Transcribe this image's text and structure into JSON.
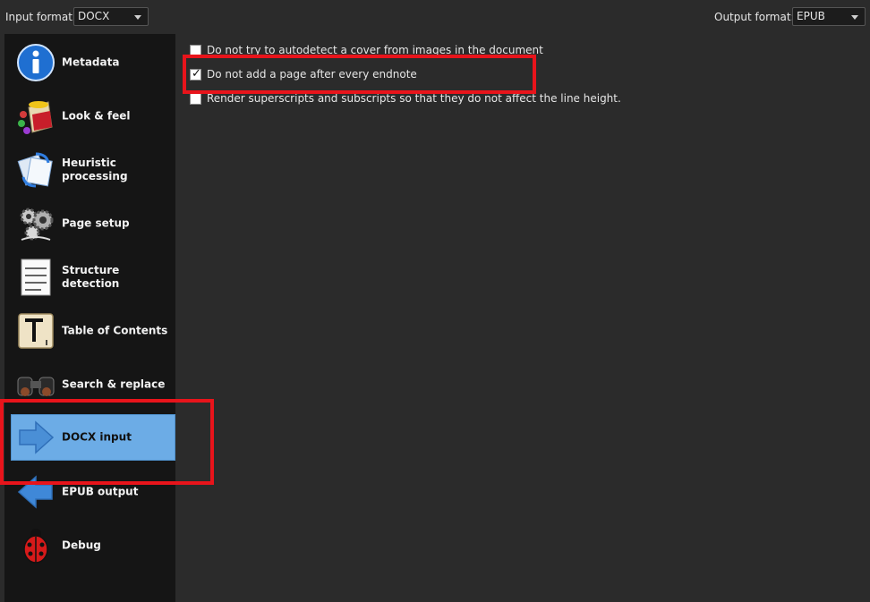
{
  "header": {
    "input_format_label": "Input format:",
    "input_format_value": "DOCX",
    "output_format_label": "Output format:",
    "output_format_value": "EPUB"
  },
  "sidebar": {
    "items": [
      {
        "label": "Metadata",
        "icon": "info-icon"
      },
      {
        "label": "Look & feel",
        "icon": "paint-bucket-icon"
      },
      {
        "label": "Heuristic processing",
        "icon": "heuristic-icon"
      },
      {
        "label": "Page setup",
        "icon": "gears-icon"
      },
      {
        "label": "Structure detection",
        "icon": "document-lines-icon"
      },
      {
        "label": "Table of Contents",
        "icon": "letter-tile-icon"
      },
      {
        "label": "Search & replace",
        "icon": "binoculars-icon"
      },
      {
        "label": "DOCX input",
        "icon": "arrow-right-icon"
      },
      {
        "label": "EPUB output",
        "icon": "arrow-left-icon"
      },
      {
        "label": "Debug",
        "icon": "ladybug-icon"
      }
    ],
    "active_index": 7
  },
  "options": [
    {
      "label": "Do not try to autodetect a cover from images in the document",
      "checked": false
    },
    {
      "label": "Do not add a page after every endnote",
      "checked": true
    },
    {
      "label": "Render superscripts and subscripts so that they do not affect the line height.",
      "checked": false
    }
  ],
  "colors": {
    "background": "#2b2b2b",
    "sidebar": "#151515",
    "active_item": "#6cace6",
    "highlight": "#e8141b"
  }
}
